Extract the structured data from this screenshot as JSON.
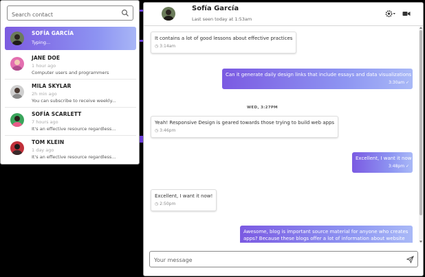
{
  "search": {
    "placeholder": "Search contact"
  },
  "contacts": [
    {
      "name": "SOFÍA GARCÍA",
      "status": "Typing...",
      "active": true
    },
    {
      "name": "JANE DOE",
      "time": "1 hour ago",
      "preview": "Computer users and programmers"
    },
    {
      "name": "MILA SKYLAR",
      "time": "2h min ago",
      "preview": "You can subscribe to receive weekly..."
    },
    {
      "name": "SOFÍA SCARLETT",
      "time": "7 hours ago",
      "preview": "It's an effective resource regardless..."
    },
    {
      "name": "TOM KLEIN",
      "time": "1 day ago",
      "preview": "It's an effective resource regardless..."
    }
  ],
  "chat": {
    "name": "Sofía García",
    "last_seen": "Last seen today at 1:53am",
    "divider": "WED, 3:27PM",
    "messages": [
      {
        "dir": "in",
        "text": [
          "It contains a lot of good lessons about effective practices"
        ],
        "time": "3:14am"
      },
      {
        "dir": "out",
        "text": [
          "Can it generate daily design links that include essays and data visualizations ?"
        ],
        "time": "3:30am"
      },
      {
        "dir": "in",
        "text": [
          "Yeah! Responsive Design is geared towards those trying to build web apps"
        ],
        "time": "3:46pm"
      },
      {
        "dir": "out",
        "text": [
          "Excellent, I want it now !"
        ],
        "time": "3:48pm"
      },
      {
        "dir": "in",
        "text": [
          "Excellent, I want it now!"
        ],
        "time": "2:50pm"
      },
      {
        "dir": "out",
        "text": [
          "Awesome, blog is important source material for anyone who creates",
          "apps? Because these blogs offer a lot of information about website"
        ],
        "time": ""
      }
    ]
  },
  "composer": {
    "placeholder": "Your message"
  },
  "colors": {
    "accent_start": "#7b5ae2",
    "accent_end": "#a9b9f7"
  }
}
